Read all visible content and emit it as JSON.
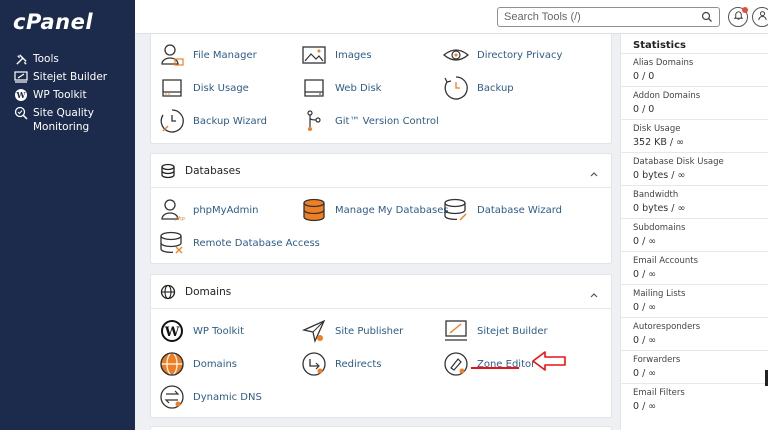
{
  "sidebar": {
    "logo": "cPanel",
    "items": [
      {
        "label": "Tools",
        "icon": "tools-icon"
      },
      {
        "label": "Sitejet Builder",
        "icon": "sitejet-icon"
      },
      {
        "label": "WP Toolkit",
        "icon": "wordpress-icon"
      },
      {
        "label": "Site Quality Monitoring",
        "icon": "site-quality-icon"
      }
    ]
  },
  "topbar": {
    "search_placeholder": "Search Tools (/)",
    "search_shortcut": "/"
  },
  "files": {
    "items": [
      {
        "label": "File Manager",
        "icon": "file-manager-icon"
      },
      {
        "label": "Images",
        "icon": "images-icon"
      },
      {
        "label": "Directory Privacy",
        "icon": "directory-privacy-icon"
      },
      {
        "label": "Disk Usage",
        "icon": "disk-usage-icon"
      },
      {
        "label": "Web Disk",
        "icon": "web-disk-icon"
      },
      {
        "label": "Backup",
        "icon": "backup-icon"
      },
      {
        "label": "Backup Wizard",
        "icon": "backup-wizard-icon"
      },
      {
        "label": "Git™ Version Control",
        "icon": "git-icon"
      }
    ]
  },
  "databases": {
    "title": "Databases",
    "items": [
      {
        "label": "phpMyAdmin",
        "icon": "phpmyadmin-icon"
      },
      {
        "label": "Manage My Databases",
        "icon": "manage-databases-icon"
      },
      {
        "label": "Database Wizard",
        "icon": "database-wizard-icon"
      },
      {
        "label": "Remote Database Access",
        "icon": "remote-database-icon"
      }
    ]
  },
  "domains": {
    "title": "Domains",
    "items": [
      {
        "label": "WP Toolkit",
        "icon": "wordpress-icon"
      },
      {
        "label": "Site Publisher",
        "icon": "site-publisher-icon"
      },
      {
        "label": "Sitejet Builder",
        "icon": "sitejet-icon"
      },
      {
        "label": "Domains",
        "icon": "domains-icon"
      },
      {
        "label": "Redirects",
        "icon": "redirects-icon"
      },
      {
        "label": "Zone Editor",
        "icon": "zone-editor-icon"
      },
      {
        "label": "Dynamic DNS",
        "icon": "dynamic-dns-icon"
      }
    ]
  },
  "stats": {
    "title": "Statistics",
    "items": [
      {
        "label": "Alias Domains",
        "value": "0 / 0"
      },
      {
        "label": "Addon Domains",
        "value": "0 / 0"
      },
      {
        "label": "Disk Usage",
        "value": "352 KB / ∞"
      },
      {
        "label": "Database Disk Usage",
        "value": "0 bytes / ∞"
      },
      {
        "label": "Bandwidth",
        "value": "0 bytes / ∞"
      },
      {
        "label": "Subdomains",
        "value": "0 / ∞"
      },
      {
        "label": "Email Accounts",
        "value": "0 / ∞"
      },
      {
        "label": "Mailing Lists",
        "value": "0 / ∞"
      },
      {
        "label": "Autoresponders",
        "value": "0 / ∞"
      },
      {
        "label": "Forwarders",
        "value": "0 / ∞"
      },
      {
        "label": "Email Filters",
        "value": "0 / ∞"
      }
    ]
  },
  "colors": {
    "sidebar_bg": "#1c2b4b",
    "link": "#2e5c8a",
    "accent_orange": "#f07e23",
    "highlight_red": "#e11111"
  }
}
